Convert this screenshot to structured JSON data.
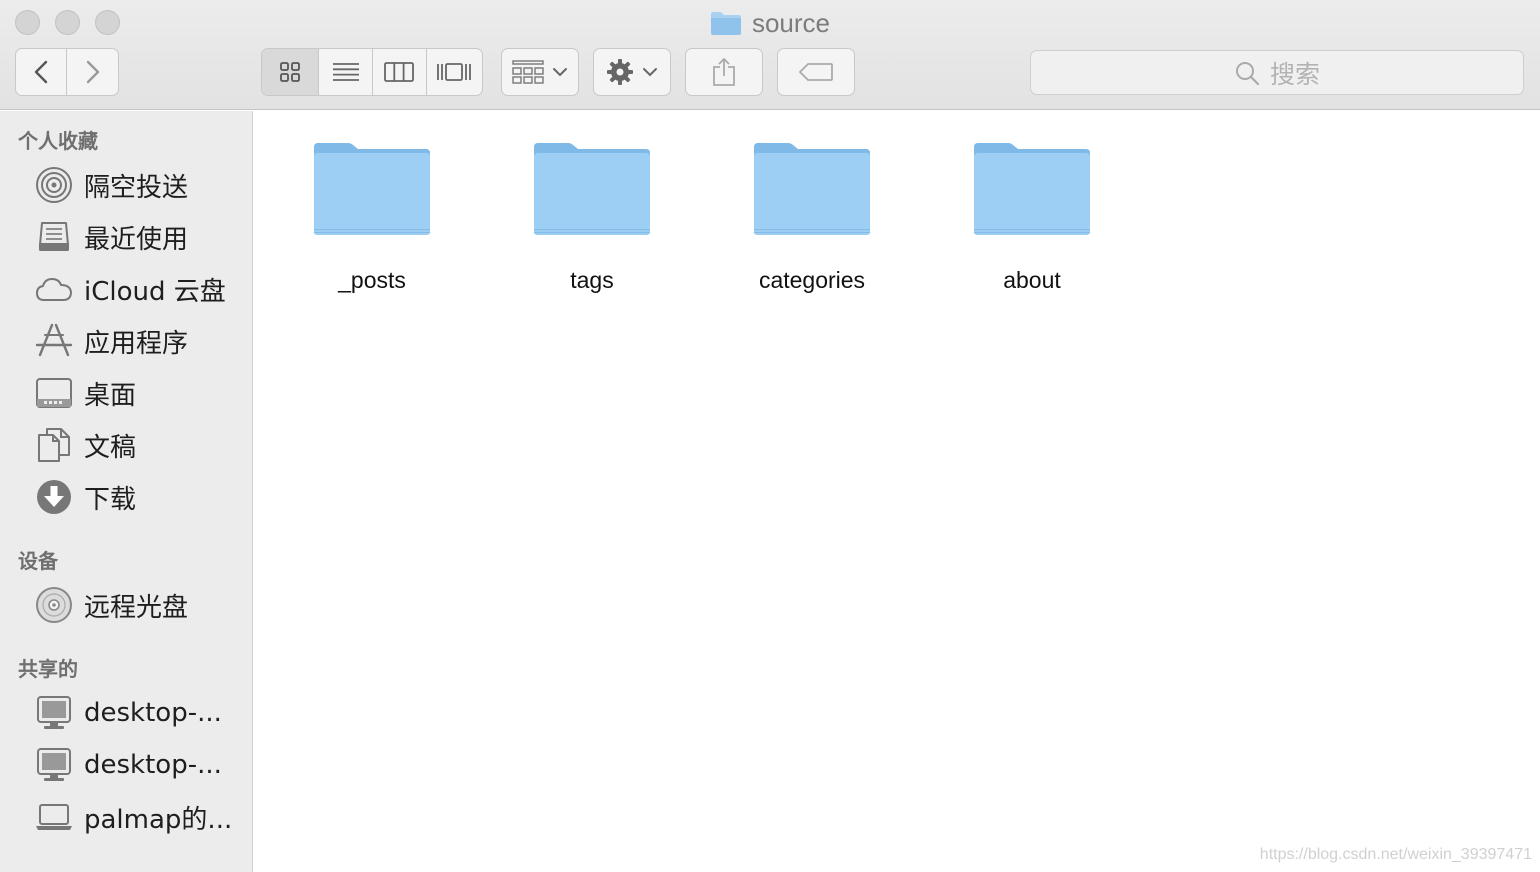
{
  "window": {
    "title": "source"
  },
  "toolbar": {
    "search_placeholder": "搜索"
  },
  "sidebar": {
    "sections": [
      {
        "header": "个人收藏",
        "items": [
          {
            "label": "隔空投送",
            "icon": "airdrop-icon"
          },
          {
            "label": "最近使用",
            "icon": "recents-icon"
          },
          {
            "label": "iCloud 云盘",
            "icon": "cloud-icon"
          },
          {
            "label": "应用程序",
            "icon": "applications-icon"
          },
          {
            "label": "桌面",
            "icon": "desktop-icon"
          },
          {
            "label": "文稿",
            "icon": "documents-icon"
          },
          {
            "label": "下载",
            "icon": "download-icon"
          }
        ]
      },
      {
        "header": "设备",
        "items": [
          {
            "label": "远程光盘",
            "icon": "optical-disc-icon"
          }
        ]
      },
      {
        "header": "共享的",
        "items": [
          {
            "label": "desktop-...",
            "icon": "monitor-icon"
          },
          {
            "label": "desktop-...",
            "icon": "monitor-icon"
          },
          {
            "label": "palmap的...",
            "icon": "laptop-icon"
          }
        ]
      }
    ]
  },
  "main": {
    "folders": [
      {
        "name": "_posts"
      },
      {
        "name": "tags"
      },
      {
        "name": "categories"
      },
      {
        "name": "about"
      }
    ]
  },
  "watermark": "https://blog.csdn.net/weixin_39397471",
  "colors": {
    "folder_blue": "#9ccdf2",
    "folder_blue_dark": "#7db8e6",
    "sidebar_bg": "#ececec"
  }
}
